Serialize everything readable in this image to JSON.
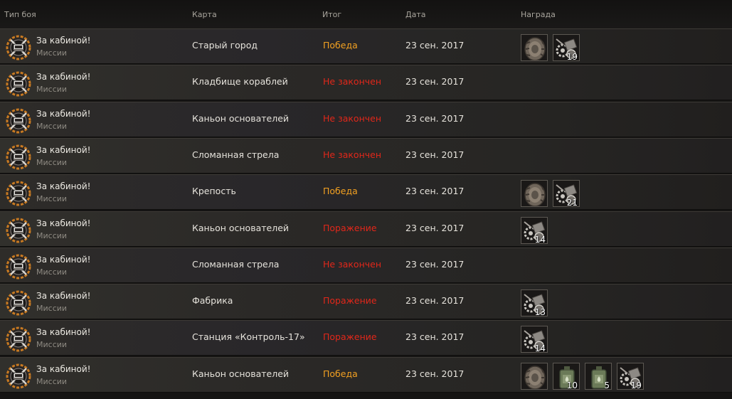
{
  "columns": {
    "battle_type": "Тип боя",
    "map": "Карта",
    "result": "Итог",
    "date": "Дата",
    "reward": "Награда"
  },
  "colors": {
    "win": "#f2a021",
    "lose": "#e1271a"
  },
  "rows": [
    {
      "title": "За кабиной!",
      "subtitle": "Миссии",
      "map": "Старый город",
      "result": "Победа",
      "result_kind": "win",
      "date": "23 сен. 2017",
      "rewards": [
        {
          "icon": "wheel-icon",
          "count": ""
        },
        {
          "icon": "gear-scrap-icon",
          "count": "19"
        }
      ]
    },
    {
      "title": "За кабиной!",
      "subtitle": "Миссии",
      "map": "Кладбище кораблей",
      "result": "Не закончен",
      "result_kind": "unfinished",
      "date": "23 сен. 2017",
      "rewards": []
    },
    {
      "title": "За кабиной!",
      "subtitle": "Миссии",
      "map": "Каньон основателей",
      "result": "Не закончен",
      "result_kind": "unfinished",
      "date": "23 сен. 2017",
      "rewards": []
    },
    {
      "title": "За кабиной!",
      "subtitle": "Миссии",
      "map": "Сломанная стрела",
      "result": "Не закончен",
      "result_kind": "unfinished",
      "date": "23 сен. 2017",
      "rewards": []
    },
    {
      "title": "За кабиной!",
      "subtitle": "Миссии",
      "map": "Крепость",
      "result": "Победа",
      "result_kind": "win",
      "date": "23 сен. 2017",
      "rewards": [
        {
          "icon": "wheel-icon",
          "count": ""
        },
        {
          "icon": "gear-scrap-icon",
          "count": "21"
        }
      ]
    },
    {
      "title": "За кабиной!",
      "subtitle": "Миссии",
      "map": "Каньон основателей",
      "result": "Поражение",
      "result_kind": "lose",
      "date": "23 сен. 2017",
      "rewards": [
        {
          "icon": "gear-scrap-icon",
          "count": "14"
        }
      ]
    },
    {
      "title": "За кабиной!",
      "subtitle": "Миссии",
      "map": "Сломанная стрела",
      "result": "Не закончен",
      "result_kind": "unfinished",
      "date": "23 сен. 2017",
      "rewards": []
    },
    {
      "title": "За кабиной!",
      "subtitle": "Миссии",
      "map": "Фабрика",
      "result": "Поражение",
      "result_kind": "lose",
      "date": "23 сен. 2017",
      "rewards": [
        {
          "icon": "gear-scrap-icon",
          "count": "13"
        }
      ]
    },
    {
      "title": "За кабиной!",
      "subtitle": "Миссии",
      "map": "Станция «Контроль-17»",
      "result": "Поражение",
      "result_kind": "lose",
      "date": "23 сен. 2017",
      "rewards": [
        {
          "icon": "gear-scrap-icon",
          "count": "14"
        }
      ]
    },
    {
      "title": "За кабиной!",
      "subtitle": "Миссии",
      "map": "Каньон основателей",
      "result": "Победа",
      "result_kind": "win",
      "date": "23 сен. 2017",
      "rewards": [
        {
          "icon": "wheel-icon",
          "count": ""
        },
        {
          "icon": "fuel-canister-icon",
          "count": "10"
        },
        {
          "icon": "fuel-canister-icon",
          "count": "5"
        },
        {
          "icon": "gear-scrap-icon",
          "count": "19"
        }
      ]
    }
  ]
}
